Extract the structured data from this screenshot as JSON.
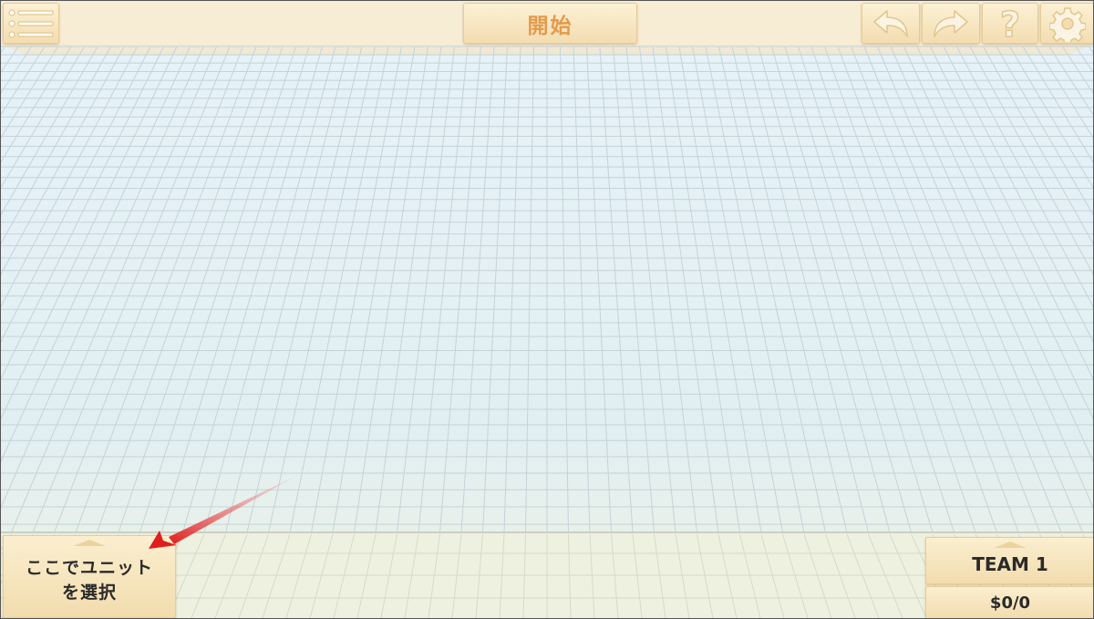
{
  "toolbar": {
    "start_label": "開始",
    "icons": {
      "menu": "list-menu-icon",
      "undo": "undo-arrow-icon",
      "redo": "redo-arrow-icon",
      "help": "question-mark-icon",
      "settings": "gear-icon"
    }
  },
  "unit_select": {
    "line1": "ここでユニット",
    "line2": "を選択"
  },
  "team": {
    "name": "TEAM 1",
    "money": "$0/0"
  },
  "colors": {
    "panel": "#f6e4bd",
    "accent_text": "#e39a4b",
    "grid_line": "#c4d3d9",
    "pointer_arrow": "#e01e1e"
  }
}
